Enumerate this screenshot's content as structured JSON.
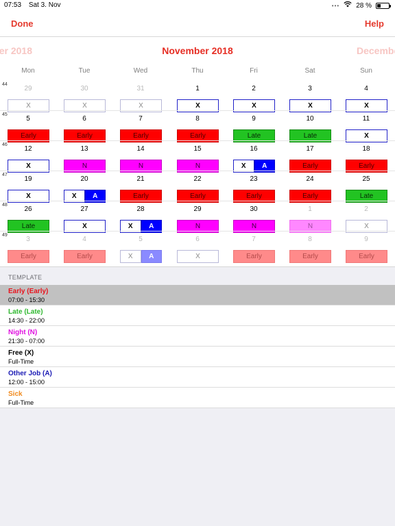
{
  "status_bar": {
    "time": "07:53",
    "date": "Sat 3. Nov",
    "battery": "28 %",
    "battery_level": 0.28,
    "wifi_icon": "wifi-icon",
    "battery_icon": "battery-icon"
  },
  "nav": {
    "done_label": "Done",
    "help_label": "Help",
    "accent_color": "#e53a2e"
  },
  "calendar": {
    "current_month": "November 2018",
    "prev_month": "October 2018",
    "next_month": "December 2018",
    "weekdays": [
      "Mon",
      "Tue",
      "Wed",
      "Thu",
      "Fri",
      "Sat",
      "Sun"
    ],
    "shift_colors": {
      "Early": "#ff0000",
      "Late": "#22c322",
      "Night": "#ff00ff",
      "Free": "#ffffff",
      "Other Job": "#0000ff"
    },
    "weeks": [
      {
        "number": "44",
        "days": [
          {
            "day": "29",
            "other": true,
            "shifts": [
              "X"
            ]
          },
          {
            "day": "30",
            "other": true,
            "shifts": [
              "X"
            ]
          },
          {
            "day": "31",
            "other": true,
            "shifts": [
              "X"
            ]
          },
          {
            "day": "1",
            "other": false,
            "shifts": [
              "X"
            ]
          },
          {
            "day": "2",
            "other": false,
            "shifts": [
              "X"
            ]
          },
          {
            "day": "3",
            "other": false,
            "shifts": [
              "X"
            ]
          },
          {
            "day": "4",
            "other": false,
            "shifts": [
              "X"
            ]
          }
        ]
      },
      {
        "number": "45",
        "days": [
          {
            "day": "5",
            "other": false,
            "shifts": [
              "Early"
            ]
          },
          {
            "day": "6",
            "other": false,
            "shifts": [
              "Early"
            ]
          },
          {
            "day": "7",
            "other": false,
            "shifts": [
              "Early"
            ]
          },
          {
            "day": "8",
            "other": false,
            "shifts": [
              "Early"
            ]
          },
          {
            "day": "9",
            "other": false,
            "shifts": [
              "Late"
            ]
          },
          {
            "day": "10",
            "other": false,
            "shifts": [
              "Late"
            ]
          },
          {
            "day": "11",
            "other": false,
            "shifts": [
              "X"
            ]
          }
        ]
      },
      {
        "number": "46",
        "days": [
          {
            "day": "12",
            "other": false,
            "shifts": [
              "X"
            ]
          },
          {
            "day": "13",
            "other": false,
            "shifts": [
              "N"
            ]
          },
          {
            "day": "14",
            "other": false,
            "shifts": [
              "N"
            ]
          },
          {
            "day": "15",
            "other": false,
            "shifts": [
              "N"
            ]
          },
          {
            "day": "16",
            "other": false,
            "shifts": [
              "X",
              "A"
            ]
          },
          {
            "day": "17",
            "other": false,
            "shifts": [
              "Early"
            ]
          },
          {
            "day": "18",
            "other": false,
            "shifts": [
              "Early"
            ]
          }
        ]
      },
      {
        "number": "47",
        "days": [
          {
            "day": "19",
            "other": false,
            "shifts": [
              "X"
            ]
          },
          {
            "day": "20",
            "other": false,
            "shifts": [
              "X",
              "A"
            ]
          },
          {
            "day": "21",
            "other": false,
            "shifts": [
              "Early"
            ]
          },
          {
            "day": "22",
            "other": false,
            "shifts": [
              "Early"
            ]
          },
          {
            "day": "23",
            "other": false,
            "shifts": [
              "Early"
            ]
          },
          {
            "day": "24",
            "other": false,
            "shifts": [
              "Early"
            ]
          },
          {
            "day": "25",
            "other": false,
            "shifts": [
              "Late"
            ]
          }
        ]
      },
      {
        "number": "48",
        "days": [
          {
            "day": "26",
            "other": false,
            "shifts": [
              "Late"
            ]
          },
          {
            "day": "27",
            "other": false,
            "shifts": [
              "X"
            ]
          },
          {
            "day": "28",
            "other": false,
            "shifts": [
              "X",
              "A"
            ]
          },
          {
            "day": "29",
            "other": false,
            "shifts": [
              "N"
            ]
          },
          {
            "day": "30",
            "other": false,
            "shifts": [
              "N"
            ]
          },
          {
            "day": "1",
            "other": true,
            "shifts": [
              "N"
            ]
          },
          {
            "day": "2",
            "other": true,
            "shifts": [
              "X"
            ]
          }
        ]
      },
      {
        "number": "49",
        "days": [
          {
            "day": "3",
            "other": true,
            "shifts": [
              "Early"
            ]
          },
          {
            "day": "4",
            "other": true,
            "shifts": [
              "Early"
            ]
          },
          {
            "day": "5",
            "other": true,
            "shifts": [
              "X",
              "A"
            ]
          },
          {
            "day": "6",
            "other": true,
            "shifts": [
              "X"
            ]
          },
          {
            "day": "7",
            "other": true,
            "shifts": [
              "Early"
            ]
          },
          {
            "day": "8",
            "other": true,
            "shifts": [
              "Early"
            ]
          },
          {
            "day": "9",
            "other": true,
            "shifts": [
              "Early"
            ]
          }
        ]
      }
    ]
  },
  "template": {
    "header": "TEMPLATE",
    "items": [
      {
        "name": "Early (Early)",
        "sub": "07:00 - 15:30",
        "color": "#e8141e",
        "selected": true
      },
      {
        "name": "Late (Late)",
        "sub": "14:30 - 22:00",
        "color": "#2fb82f",
        "selected": false
      },
      {
        "name": "Night (N)",
        "sub": "21:30 - 07:00",
        "color": "#e010e0",
        "selected": false
      },
      {
        "name": "Free (X)",
        "sub": "Full-Time",
        "color": "#000000",
        "selected": false
      },
      {
        "name": "Other Job (A)",
        "sub": "12:00 - 15:00",
        "color": "#1a1ab4",
        "selected": false
      },
      {
        "name": "Sick",
        "sub": "Full-Time",
        "color": "#f08a1e",
        "selected": false
      }
    ]
  }
}
